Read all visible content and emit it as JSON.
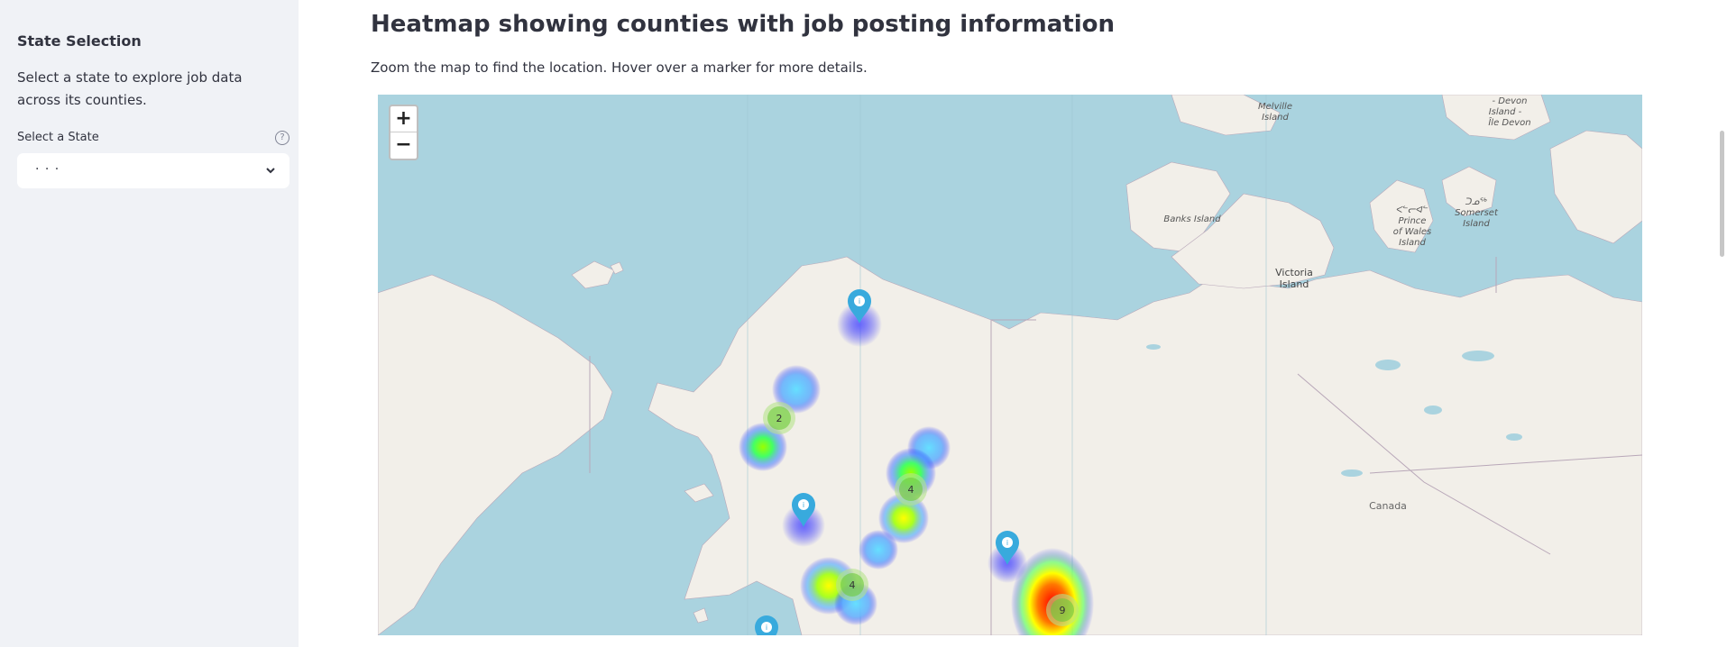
{
  "sidebar": {
    "title": "State Selection",
    "description": "Select a state to explore job data across its counties.",
    "select_label": "Select a State",
    "help_icon": "question-icon",
    "selected_value": "· · ·"
  },
  "main": {
    "title": "Heatmap showing counties with job posting information",
    "description": "Zoom the map to find the location. Hover over a marker for more details."
  },
  "map": {
    "zoom_in": "+",
    "zoom_out": "−",
    "labels": [
      {
        "text": "Melville",
        "id": "melville-1"
      },
      {
        "text": "Island",
        "id": "melville-2"
      },
      {
        "text": "- Devon",
        "id": "devon-1"
      },
      {
        "text": "Island -",
        "id": "devon-2"
      },
      {
        "text": "Île Devon",
        "id": "devon-3"
      },
      {
        "text": "Banks Island",
        "id": "banks"
      },
      {
        "text": "ᐸᓪᓕᐊᓪ",
        "id": "pow-0"
      },
      {
        "text": "Prince",
        "id": "pow-1"
      },
      {
        "text": "of Wales",
        "id": "pow-2"
      },
      {
        "text": "Island",
        "id": "pow-3"
      },
      {
        "text": "ᑐᓄᖅ",
        "id": "som-0"
      },
      {
        "text": "Somerset",
        "id": "som-1"
      },
      {
        "text": "Island",
        "id": "som-2"
      },
      {
        "text": "Victoria",
        "id": "vic-1"
      },
      {
        "text": "Island",
        "id": "vic-2"
      },
      {
        "text": "Canada",
        "id": "canada"
      }
    ],
    "clusters": [
      {
        "count": "2"
      },
      {
        "count": "4"
      },
      {
        "count": "4"
      },
      {
        "count": "9"
      }
    ],
    "marker_icon": "info-icon",
    "colors": {
      "water": "#aad3df",
      "land": "#f2efe9",
      "marker": "#38aadd"
    }
  }
}
